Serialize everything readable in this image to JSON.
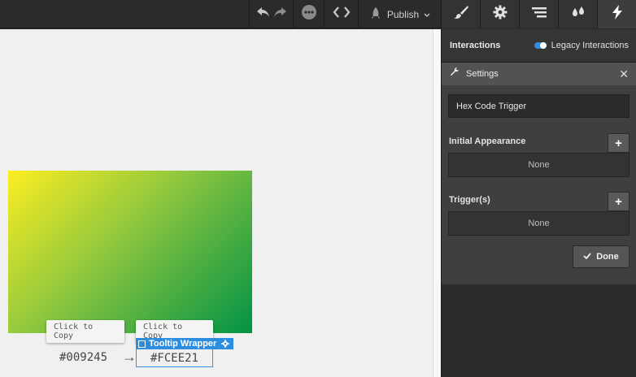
{
  "toolbar": {
    "publish_label": "Publish",
    "icons": [
      "undo-icon",
      "redo-icon",
      "more-icon",
      "code-icon",
      "publish-rocket-icon",
      "style-brush-icon",
      "settings-gear-icon",
      "navigator-icon",
      "assets-drops-icon",
      "interactions-bolt-icon"
    ]
  },
  "canvas": {
    "gradient": {
      "start_color": "#FCEE21",
      "end_color": "#009245"
    },
    "tooltip_1": "Click to Copy",
    "tooltip_2": "Click to Copy",
    "hex_1": "#009245",
    "arrow": "→",
    "hex_2": "#FCEE21",
    "selection_label": "Tooltip Wrapper"
  },
  "panel": {
    "title": "Interactions",
    "legacy_label": "Legacy Interactions",
    "settings_label": "Settings",
    "close_glyph": "✕",
    "interaction_name": "Hex Code Trigger",
    "initial_appearance_label": "Initial Appearance",
    "initial_appearance_value": "None",
    "triggers_label": "Trigger(s)",
    "triggers_value": "None",
    "add_glyph": "+",
    "done_label": "Done"
  },
  "colors": {
    "accent": "#2d8ee0",
    "panel_bg": "#2b2b2b",
    "canvas_bg": "#f0f0f0"
  }
}
